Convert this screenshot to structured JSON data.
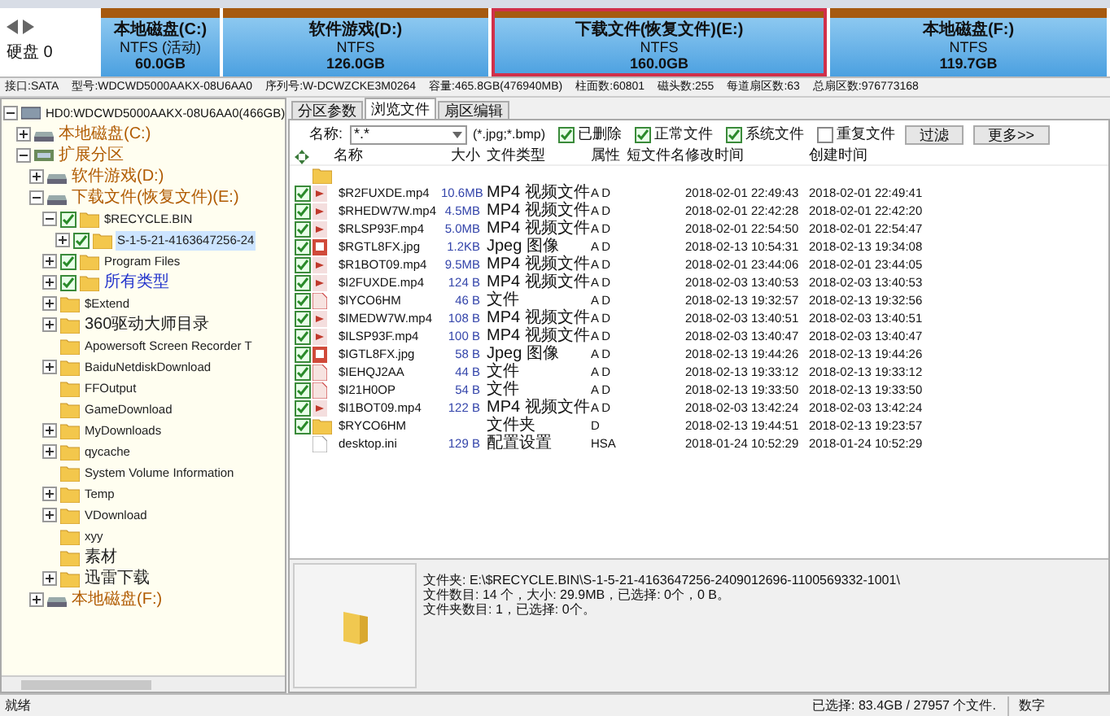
{
  "disk_bar": {
    "label": "硬盘 0",
    "partitions": [
      {
        "name": "本地磁盘(C:)",
        "fs": "NTFS (活动)",
        "size": "60.0GB",
        "selected": false
      },
      {
        "name": "软件游戏(D:)",
        "fs": "NTFS",
        "size": "126.0GB",
        "selected": false
      },
      {
        "name": "下载文件(恢复文件)(E:)",
        "fs": "NTFS",
        "size": "160.0GB",
        "selected": true
      },
      {
        "name": "本地磁盘(F:)",
        "fs": "NTFS",
        "size": "119.7GB",
        "selected": false
      }
    ]
  },
  "disk_info": [
    "接口:SATA",
    "型号:WDCWD5000AAKX-08U6AA0",
    "序列号:W-DCWZCKE3M0264",
    "容量:465.8GB(476940MB)",
    "柱面数:60801",
    "磁头数:255",
    "每道扇区数:63",
    "总扇区数:976773168"
  ],
  "tree": [
    {
      "label": "HD0:WDCWD5000AAKX-08U6AA0(466GB)",
      "kind": "disk",
      "expanded": true,
      "children": [
        {
          "label": "本地磁盘(C:)",
          "kind": "drive",
          "expanded": false
        },
        {
          "label": "扩展分区",
          "kind": "extended",
          "expanded": true,
          "children": [
            {
              "label": "软件游戏(D:)",
              "kind": "drive",
              "expanded": false
            },
            {
              "label": "下载文件(恢复文件)(E:)",
              "kind": "drive",
              "expanded": true,
              "children": [
                {
                  "label": "$RECYCLE.BIN",
                  "kind": "folder",
                  "checked": true,
                  "expanded": true,
                  "children": [
                    {
                      "label": "S-1-5-21-4163647256-24",
                      "kind": "folder",
                      "checked": true,
                      "expanded": false,
                      "selected": true
                    }
                  ]
                },
                {
                  "label": "Program Files",
                  "kind": "folder",
                  "checked": true,
                  "expanded": false
                },
                {
                  "label": "所有类型",
                  "kind": "virtual",
                  "checked": true,
                  "expanded": false
                },
                {
                  "label": "$Extend",
                  "kind": "folder",
                  "checked": false,
                  "expanded": false
                },
                {
                  "label": "360驱动大师目录",
                  "kind": "folder",
                  "checked": false,
                  "expanded": false
                },
                {
                  "label": "Apowersoft Screen Recorder T",
                  "kind": "folder",
                  "checked": false
                },
                {
                  "label": "BaiduNetdiskDownload",
                  "kind": "folder",
                  "checked": false,
                  "expanded": false
                },
                {
                  "label": "FFOutput",
                  "kind": "folder",
                  "checked": false
                },
                {
                  "label": "GameDownload",
                  "kind": "folder",
                  "checked": false
                },
                {
                  "label": "MyDownloads",
                  "kind": "folder",
                  "checked": false,
                  "expanded": false
                },
                {
                  "label": "qycache",
                  "kind": "folder",
                  "checked": false,
                  "expanded": false
                },
                {
                  "label": "System Volume Information",
                  "kind": "folder",
                  "checked": false
                },
                {
                  "label": "Temp",
                  "kind": "folder",
                  "checked": false,
                  "expanded": false
                },
                {
                  "label": "VDownload",
                  "kind": "folder",
                  "checked": false,
                  "expanded": false
                },
                {
                  "label": "xyy",
                  "kind": "folder",
                  "checked": false
                },
                {
                  "label": "素材",
                  "kind": "folder",
                  "checked": false
                },
                {
                  "label": "迅雷下载",
                  "kind": "folder",
                  "checked": false,
                  "expanded": false
                }
              ]
            },
            {
              "label": "本地磁盘(F:)",
              "kind": "drive",
              "expanded": false
            }
          ]
        }
      ]
    }
  ],
  "tabs": [
    {
      "label": "分区参数",
      "selected": false
    },
    {
      "label": "浏览文件",
      "selected": true
    },
    {
      "label": "扇区编辑",
      "selected": false
    }
  ],
  "filter": {
    "name_label": "名称:",
    "name_value": "*.*",
    "hint": "(*.jpg;*.bmp)",
    "options": [
      {
        "label": "已删除",
        "checked": true
      },
      {
        "label": "正常文件",
        "checked": true
      },
      {
        "label": "系统文件",
        "checked": true
      },
      {
        "label": "重复文件",
        "checked": false
      }
    ],
    "buttons": [
      "过滤",
      "更多>>"
    ]
  },
  "table": {
    "columns": [
      "名称",
      "大小",
      "文件类型",
      "属性",
      "短文件名",
      "修改时间",
      "创建时间"
    ],
    "rows": [
      {
        "kind": "parent"
      },
      {
        "kind": "video",
        "checked": true,
        "name": "$R2FUXDE.mp4",
        "size": "10.6MB",
        "type": "MP4 视频文件",
        "attr": "A D",
        "modified": "2018-02-01 22:49:43",
        "created": "2018-02-01 22:49:41"
      },
      {
        "kind": "video",
        "checked": true,
        "name": "$RHEDW7W.mp4",
        "size": "4.5MB",
        "type": "MP4 视频文件",
        "attr": "A D",
        "modified": "2018-02-01 22:42:28",
        "created": "2018-02-01 22:42:20"
      },
      {
        "kind": "video",
        "checked": true,
        "name": "$RLSP93F.mp4",
        "size": "5.0MB",
        "type": "MP4 视频文件",
        "attr": "A D",
        "modified": "2018-02-01 22:54:50",
        "created": "2018-02-01 22:54:47"
      },
      {
        "kind": "image",
        "checked": true,
        "name": "$RGTL8FX.jpg",
        "size": "1.2KB",
        "type": "Jpeg 图像",
        "attr": "A D",
        "modified": "2018-02-13 10:54:31",
        "created": "2018-02-13 19:34:08"
      },
      {
        "kind": "video",
        "checked": true,
        "name": "$R1BOT09.mp4",
        "size": "9.5MB",
        "type": "MP4 视频文件",
        "attr": "A D",
        "modified": "2018-02-01 23:44:06",
        "created": "2018-02-01 23:44:05"
      },
      {
        "kind": "video",
        "checked": true,
        "name": "$I2FUXDE.mp4",
        "size": "124 B",
        "type": "MP4 视频文件",
        "attr": "A D",
        "modified": "2018-02-03 13:40:53",
        "created": "2018-02-03 13:40:53"
      },
      {
        "kind": "file",
        "checked": true,
        "name": "$IYCO6HM",
        "size": "46 B",
        "type": "文件",
        "attr": "A D",
        "modified": "2018-02-13 19:32:57",
        "created": "2018-02-13 19:32:56"
      },
      {
        "kind": "video",
        "checked": true,
        "name": "$IMEDW7W.mp4",
        "size": "108 B",
        "type": "MP4 视频文件",
        "attr": "A D",
        "modified": "2018-02-03 13:40:51",
        "created": "2018-02-03 13:40:51"
      },
      {
        "kind": "video",
        "checked": true,
        "name": "$ILSP93F.mp4",
        "size": "100 B",
        "type": "MP4 视频文件",
        "attr": "A D",
        "modified": "2018-02-03 13:40:47",
        "created": "2018-02-03 13:40:47"
      },
      {
        "kind": "image",
        "checked": true,
        "name": "$IGTL8FX.jpg",
        "size": "58 B",
        "type": "Jpeg 图像",
        "attr": "A D",
        "modified": "2018-02-13 19:44:26",
        "created": "2018-02-13 19:44:26"
      },
      {
        "kind": "file",
        "checked": true,
        "name": "$IEHQJ2AA",
        "size": "44 B",
        "type": "文件",
        "attr": "A D",
        "modified": "2018-02-13 19:33:12",
        "created": "2018-02-13 19:33:12"
      },
      {
        "kind": "file",
        "checked": true,
        "name": "$I21H0OP",
        "size": "54 B",
        "type": "文件",
        "attr": "A D",
        "modified": "2018-02-13 19:33:50",
        "created": "2018-02-13 19:33:50"
      },
      {
        "kind": "video",
        "checked": true,
        "name": "$I1BOT09.mp4",
        "size": "122 B",
        "type": "MP4 视频文件",
        "attr": "A D",
        "modified": "2018-02-03 13:42:24",
        "created": "2018-02-03 13:42:24"
      },
      {
        "kind": "folder",
        "checked": true,
        "name": "$RYCO6HM",
        "type": "文件夹",
        "attr": "D",
        "modified": "2018-02-13 19:44:51",
        "created": "2018-02-13 19:23:57"
      },
      {
        "kind": "settings",
        "checked": false,
        "name": "desktop.ini",
        "size": "129 B",
        "type": "配置设置",
        "attr": "HSA",
        "modified": "2018-01-24 10:52:29",
        "created": "2018-01-24 10:52:29"
      }
    ]
  },
  "preview": {
    "lines": [
      "文件夹: E:\\$RECYCLE.BIN\\S-1-5-21-4163647256-2409012696-1100569332-1001\\",
      "文件数目: 14 个，大小: 29.9MB，已选择: 0个，0 B。",
      "文件夹数目: 1，已选择: 0个。"
    ]
  },
  "status_bar": {
    "left": "就绪",
    "selected": "已选择: 83.4GB / 27957 个文件.",
    "mode": "数字"
  }
}
